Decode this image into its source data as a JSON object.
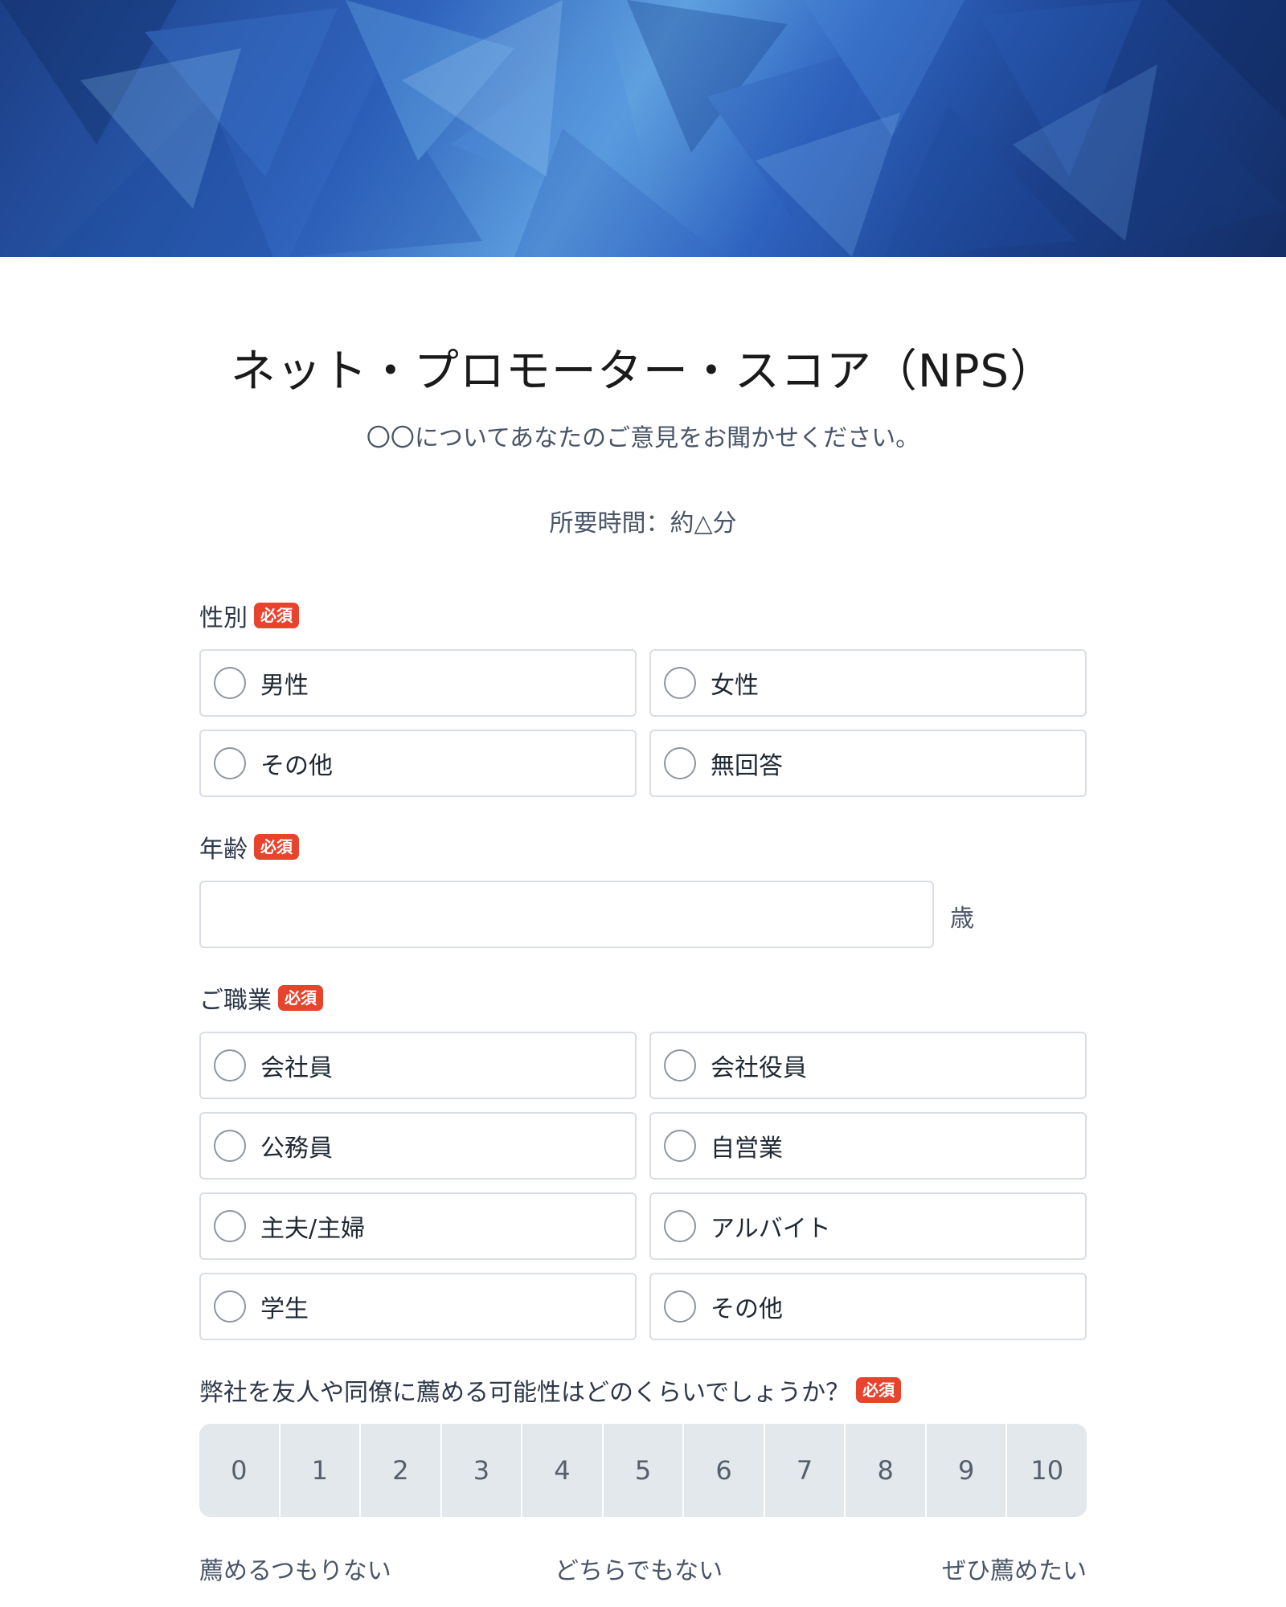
{
  "form": {
    "title": "ネット・プロモーター・スコア（NPS）",
    "subtitle": "〇〇についてあなたのご意見をお聞かせください。",
    "duration": "所要時間：約△分",
    "required_label": "必須"
  },
  "questions": {
    "gender": {
      "label": "性別",
      "options": [
        "男性",
        "女性",
        "その他",
        "無回答"
      ]
    },
    "age": {
      "label": "年齢",
      "value": "",
      "unit": "歳"
    },
    "occupation": {
      "label": "ご職業",
      "options": [
        "会社員",
        "会社役員",
        "公務員",
        "自営業",
        "主夫/主婦",
        "アルバイト",
        "学生",
        "その他"
      ]
    },
    "recommend": {
      "label": "弊社を友人や同僚に薦める可能性はどのくらいでしょうか？",
      "scale": [
        "0",
        "1",
        "2",
        "3",
        "4",
        "5",
        "6",
        "7",
        "8",
        "9",
        "10"
      ],
      "anchor_low": "薦めるつもりない",
      "anchor_mid": "どちらでもない",
      "anchor_high": "ぜひ薦めたい"
    }
  },
  "colors": {
    "accent_required": "#e8432d",
    "banner_primary": "#2f63bd",
    "border": "#d9dee4",
    "scale_bg": "#e3e8ec"
  }
}
